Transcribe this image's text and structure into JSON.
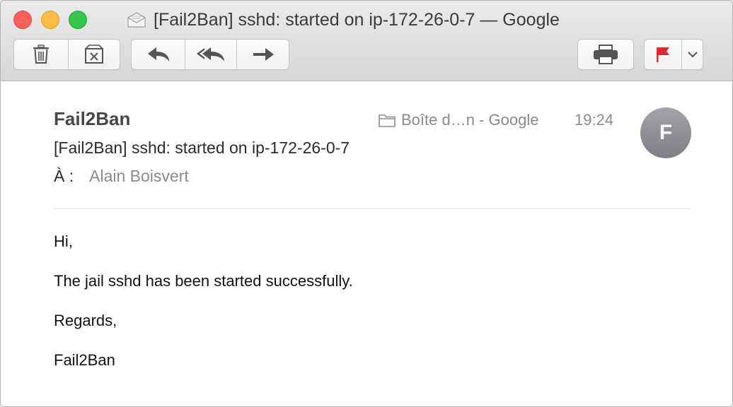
{
  "window": {
    "title": "[Fail2Ban] sshd: started on ip-172-26-0-7 — Google"
  },
  "toolbar": {
    "buttons": [
      {
        "name": "delete",
        "icon": "trash-icon"
      },
      {
        "name": "junk",
        "icon": "junk-icon"
      },
      {
        "name": "reply",
        "icon": "reply-icon"
      },
      {
        "name": "reply-all",
        "icon": "reply-all-icon"
      },
      {
        "name": "forward",
        "icon": "forward-icon"
      },
      {
        "name": "print",
        "icon": "printer-icon"
      },
      {
        "name": "flag",
        "icon": "flag-icon"
      },
      {
        "name": "flag-menu",
        "icon": "chevron-down-icon"
      }
    ],
    "flag_color": "#e8262c"
  },
  "message": {
    "sender": "Fail2Ban",
    "mailbox": "Boîte d…n - Google",
    "time": "19:24",
    "avatar_initial": "F",
    "subject": "[Fail2Ban] sshd: started on ip-172-26-0-7",
    "to_label": "À :",
    "to_value": "Alain Boisvert",
    "body": [
      "Hi,",
      "The jail sshd has been started successfully.",
      "Regards,",
      "Fail2Ban"
    ]
  }
}
